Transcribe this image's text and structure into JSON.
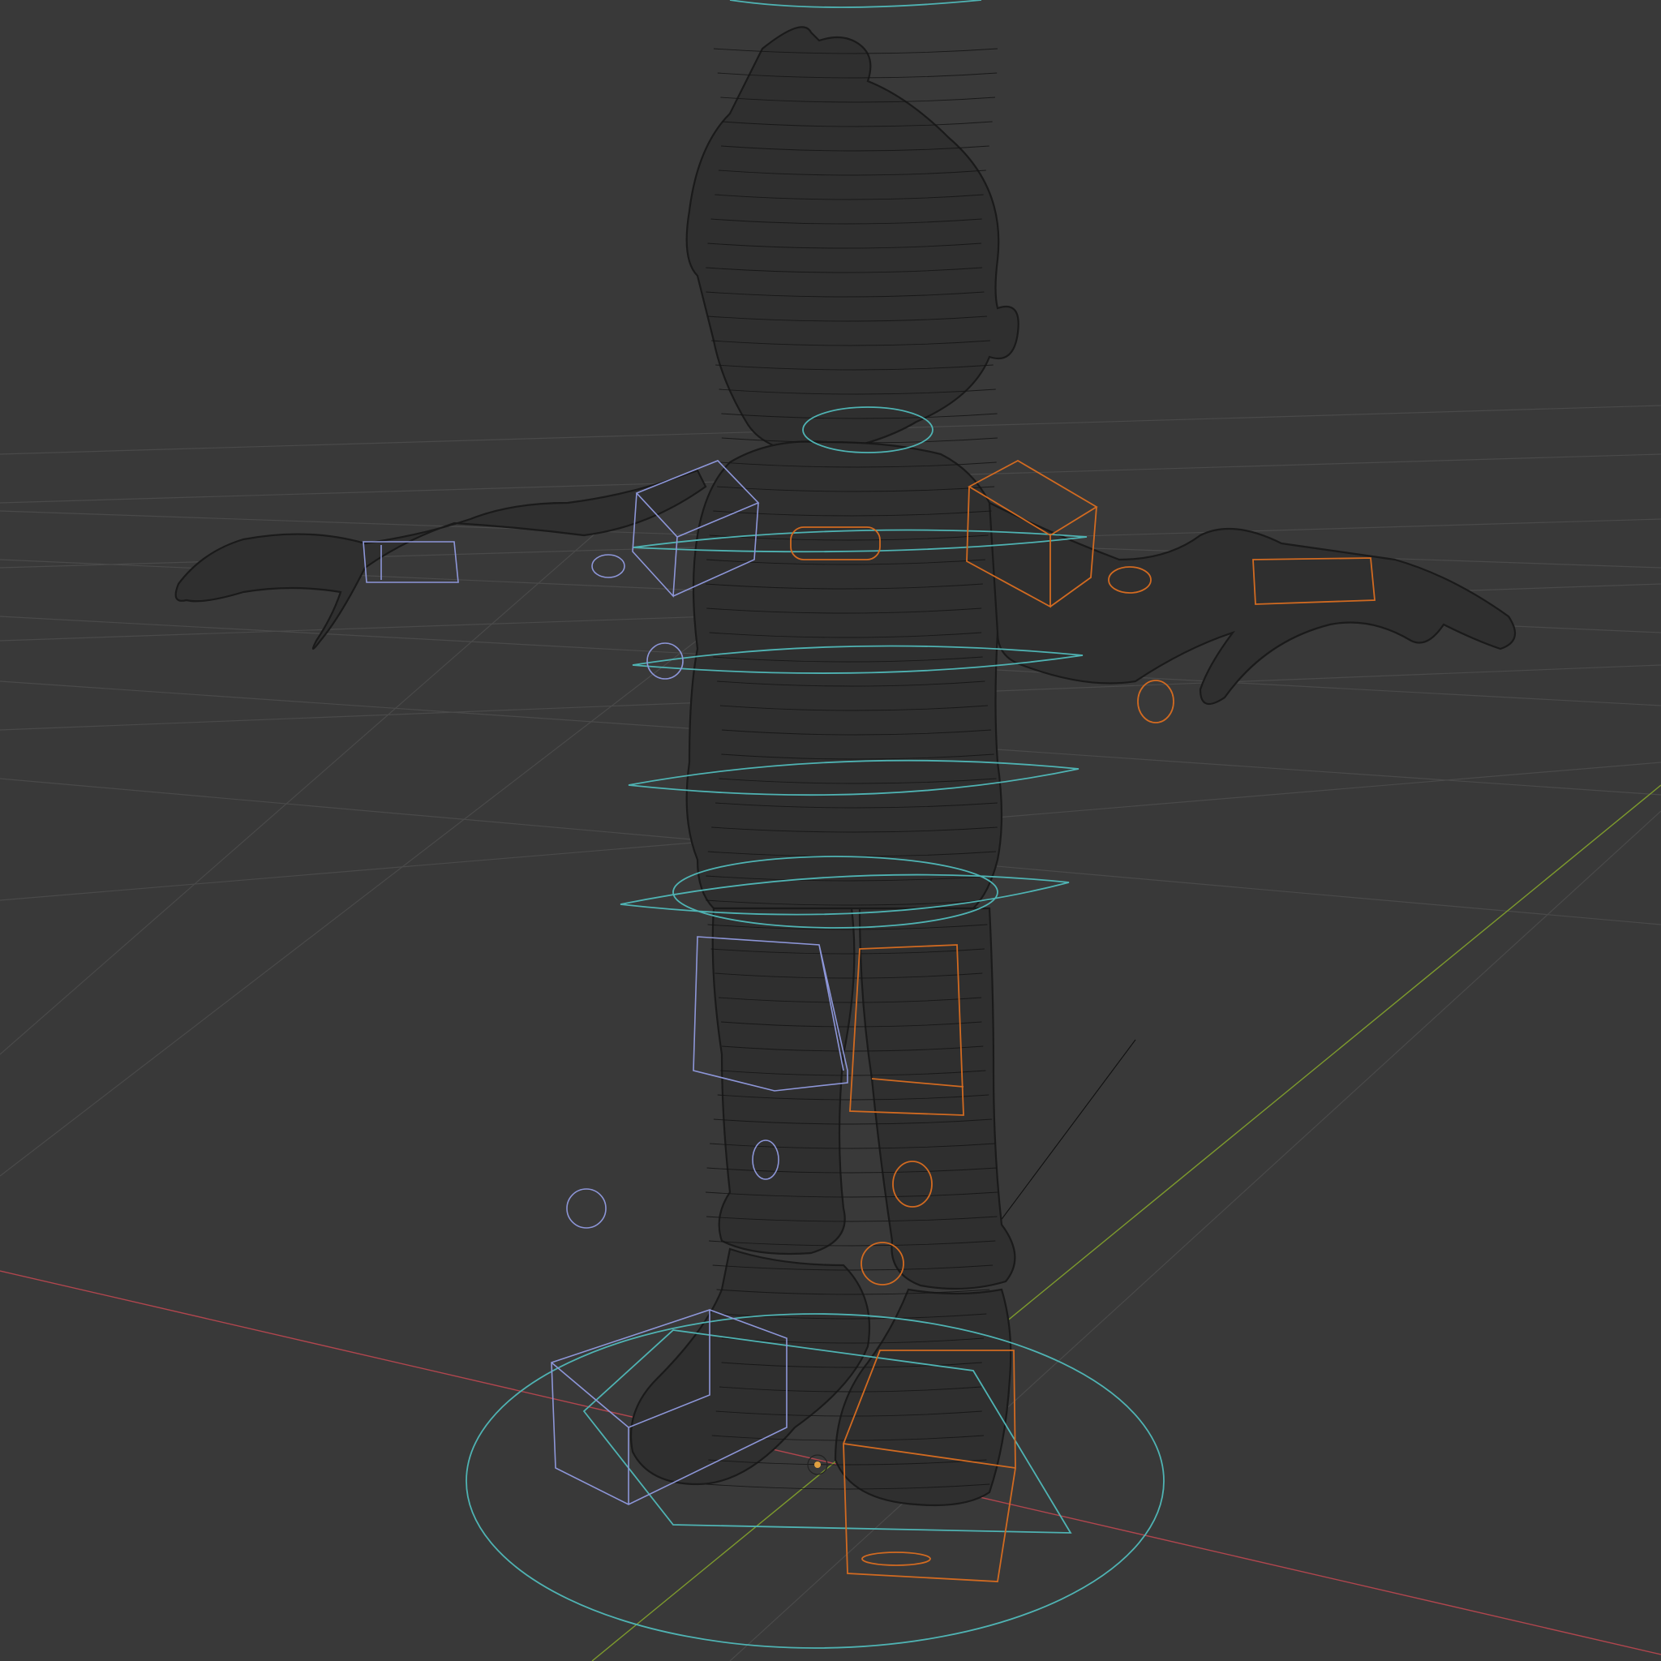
{
  "viewport": {
    "mode": "wireframe",
    "background_color": "#393939",
    "grid_color": "#4a4a4a",
    "x_axis_color": "#b0464e",
    "y_axis_color": "#7d9a2d",
    "mesh_color": "#2f2f2f"
  },
  "rig_controls": {
    "center_color": "#4fb3b3",
    "left_color": "#8d96d8",
    "right_color": "#d16a21"
  },
  "scene_objects": [
    "character-mesh",
    "root-control",
    "torso-controls",
    "left-arm-controls",
    "right-arm-controls",
    "left-leg-controls",
    "right-leg-controls",
    "origin-marker"
  ]
}
